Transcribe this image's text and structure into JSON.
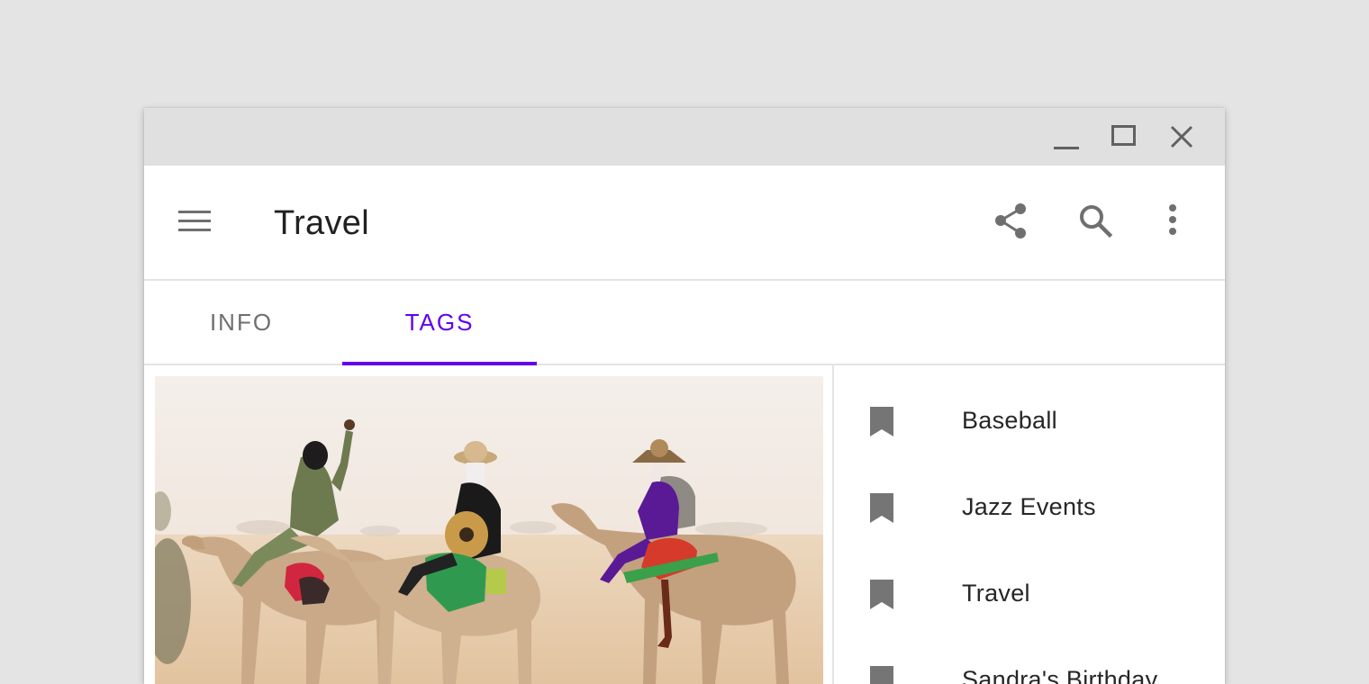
{
  "app_bar": {
    "title": "Travel",
    "icons": [
      "menu-icon",
      "share-icon",
      "search-icon",
      "more-vert-icon"
    ]
  },
  "window_controls": [
    "minimize-icon",
    "maximize-icon",
    "close-icon"
  ],
  "tabs": [
    {
      "label": "INFO",
      "active": false
    },
    {
      "label": "TAGS",
      "active": true
    }
  ],
  "tags": [
    {
      "label": "Baseball",
      "icon": "bookmark-icon"
    },
    {
      "label": "Jazz Events",
      "icon": "bookmark-icon"
    },
    {
      "label": "Travel",
      "icon": "bookmark-icon"
    },
    {
      "label": "Sandra's Birthday",
      "icon": "bookmark-icon"
    }
  ],
  "colors": {
    "accent": "#6200ee",
    "icon": "#6f6f6f",
    "titlebar": "#e0e0e0",
    "background": "#e4e4e4"
  }
}
